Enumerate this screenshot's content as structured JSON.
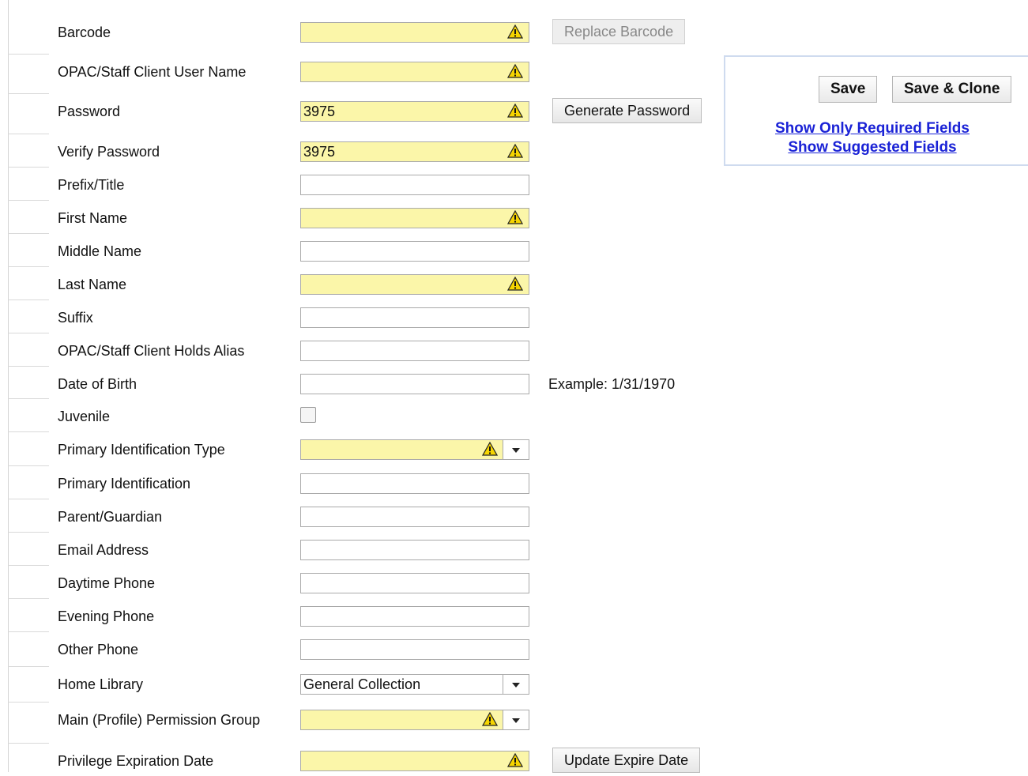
{
  "form": {
    "fields": [
      {
        "label": "Barcode",
        "value": "",
        "required": true
      },
      {
        "label": "OPAC/Staff Client User Name",
        "value": "",
        "required": true
      },
      {
        "label": "Password",
        "value": "3975",
        "required": true
      },
      {
        "label": "Verify Password",
        "value": "3975",
        "required": true
      },
      {
        "label": "Prefix/Title",
        "value": "",
        "required": false
      },
      {
        "label": "First Name",
        "value": "",
        "required": true
      },
      {
        "label": "Middle Name",
        "value": "",
        "required": false
      },
      {
        "label": "Last Name",
        "value": "",
        "required": true
      },
      {
        "label": "Suffix",
        "value": "",
        "required": false
      },
      {
        "label": "OPAC/Staff Client Holds Alias",
        "value": "",
        "required": false
      },
      {
        "label": "Date of Birth",
        "value": "",
        "required": false
      },
      {
        "label": "Juvenile",
        "value": "",
        "checked": false
      },
      {
        "label": "Primary Identification Type",
        "value": "",
        "required": true
      },
      {
        "label": "Primary Identification",
        "value": "",
        "required": false
      },
      {
        "label": "Parent/Guardian",
        "value": "",
        "required": false
      },
      {
        "label": "Email Address",
        "value": "",
        "required": false
      },
      {
        "label": "Daytime Phone",
        "value": "",
        "required": false
      },
      {
        "label": "Evening Phone",
        "value": "",
        "required": false
      },
      {
        "label": "Other Phone",
        "value": "",
        "required": false
      },
      {
        "label": "Home Library",
        "value": "General Collection",
        "required": false
      },
      {
        "label": "Main (Profile) Permission Group",
        "value": "",
        "required": true
      },
      {
        "label": "Privilege Expiration Date",
        "value": "",
        "required": true
      }
    ],
    "replace_barcode_label": "Replace Barcode",
    "generate_password_label": "Generate Password",
    "update_expire_date_label": "Update Expire Date",
    "dob_example": "Example: 1/31/1970"
  },
  "actions": {
    "save_label": "Save",
    "save_clone_label": "Save & Clone",
    "show_required_label": "Show Only Required Fields",
    "show_suggested_label": "Show Suggested Fields"
  },
  "colors": {
    "required_bg": "#fbf6a9",
    "link": "#1a22d6",
    "warning_icon": "#f5d400"
  },
  "icons": {
    "warning": "warning-icon",
    "dropdown": "chevron-down-icon"
  }
}
